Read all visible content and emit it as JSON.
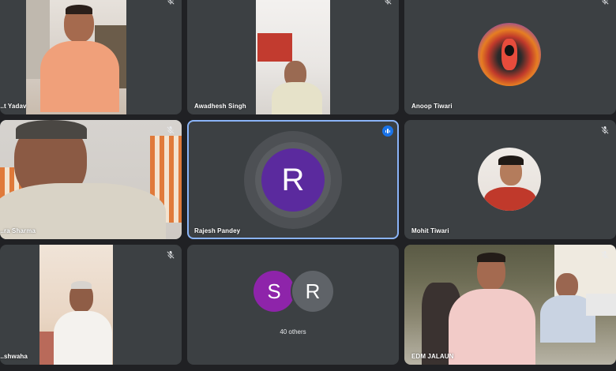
{
  "participants": [
    {
      "name": "...t Yadav",
      "muted": true
    },
    {
      "name": "Awadhesh Singh",
      "muted": true
    },
    {
      "name": "Anoop Tiwari",
      "muted": true
    },
    {
      "name": "...ra Sharma",
      "muted": true
    },
    {
      "name": "Rajesh Pandey",
      "avatar_letter": "R",
      "avatar_color": "#5b2a9e",
      "speaking": true
    },
    {
      "name": "Mohit Tiwari",
      "muted": true
    },
    {
      "name": "...shwaha",
      "muted": true
    },
    {
      "name": "EDM JALAUN",
      "muted": true
    }
  ],
  "others_tile": {
    "avatars": [
      {
        "letter": "S",
        "color": "#8e24aa"
      },
      {
        "letter": "R",
        "color": "#5f6368"
      }
    ],
    "label": "40 others"
  },
  "icons": {
    "mute": "mic-off-icon",
    "speaking": "audio-level-icon"
  }
}
